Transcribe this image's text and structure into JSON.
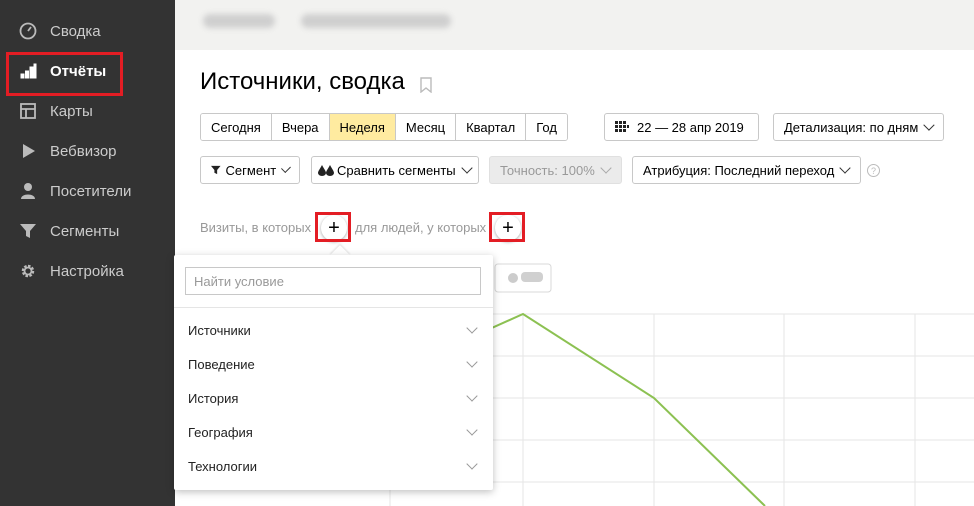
{
  "sidebar": {
    "items": [
      {
        "label": "Сводка",
        "icon": "dashboard-icon"
      },
      {
        "label": "Отчёты",
        "icon": "bar-chart-icon"
      },
      {
        "label": "Карты",
        "icon": "map-icon"
      },
      {
        "label": "Вебвизор",
        "icon": "play-icon"
      },
      {
        "label": "Посетители",
        "icon": "user-icon"
      },
      {
        "label": "Сегменты",
        "icon": "filter-icon"
      },
      {
        "label": "Настройка",
        "icon": "gear-icon"
      }
    ]
  },
  "page": {
    "title": "Источники, сводка"
  },
  "period": {
    "options": [
      "Сегодня",
      "Вчера",
      "Неделя",
      "Месяц",
      "Квартал",
      "Год"
    ],
    "selected": "Неделя"
  },
  "date_range": "22 — 28 апр 2019",
  "detail": "Детализация: по дням",
  "toolbar": {
    "segment": "Сегмент",
    "compare": "Сравнить сегменты",
    "accuracy": "Точность: 100%",
    "attribution": "Атрибуция: Последний переход",
    "help": "?"
  },
  "condition": {
    "visits_label": "Визиты, в которых",
    "people_label": "для людей, у которых",
    "plus": "+"
  },
  "popup": {
    "search_placeholder": "Найти условие",
    "items": [
      "Источники",
      "Поведение",
      "История",
      "География",
      "Технологии"
    ]
  },
  "colors": {
    "sidebar_bg": "#333333",
    "selected_period": "#ffeba0",
    "highlight": "#e31d24",
    "chart_line": "#8cc152"
  }
}
